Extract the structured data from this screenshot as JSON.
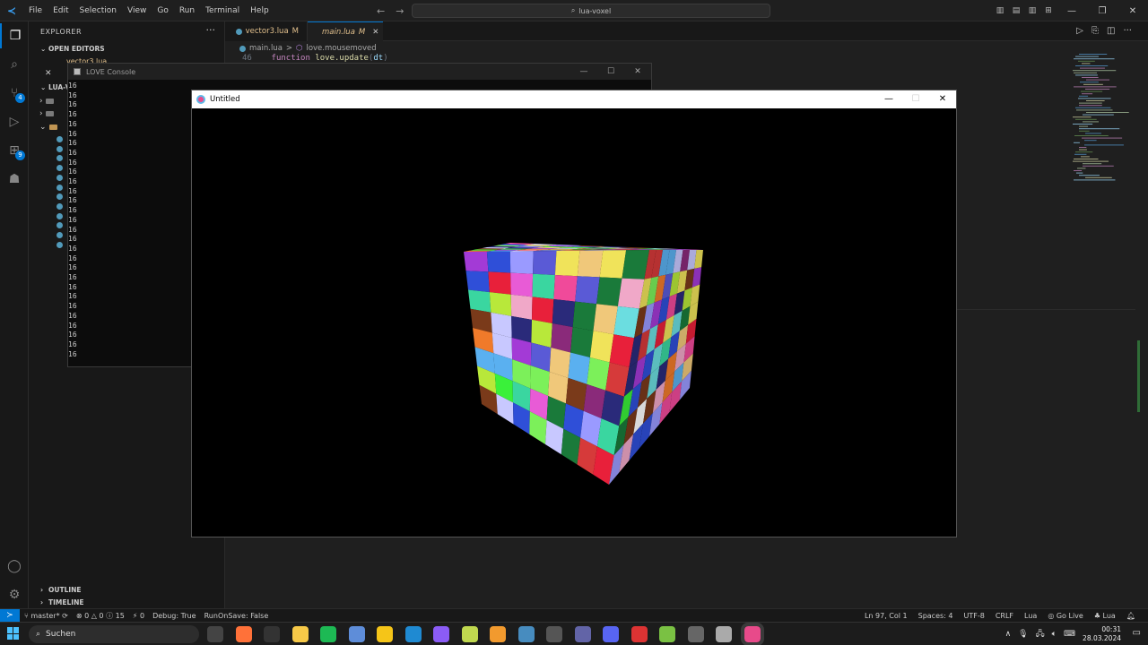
{
  "menu": [
    "File",
    "Edit",
    "Selection",
    "View",
    "Go",
    "Run",
    "Terminal",
    "Help"
  ],
  "command_center": "lua-voxel",
  "sidebar": {
    "header": "EXPLORER",
    "open_editors": {
      "title": "OPEN EDITORS",
      "items": [
        {
          "name": "vector3.lua",
          "status": "M"
        }
      ]
    },
    "workspace_title": "LUA-VO",
    "outline_title": "OUTLINE",
    "timeline_title": "TIMELINE"
  },
  "tabs": [
    {
      "label": "vector3.lua",
      "status": "M"
    },
    {
      "label": "main.lua",
      "status": "M"
    }
  ],
  "breadcrumb": {
    "file": "main.lua",
    "separator": ">",
    "symbol": "love.mousemoved"
  },
  "code_peek": {
    "line_no": "46",
    "keyword": "function",
    "name": "love.update",
    "param": "dt"
  },
  "console": {
    "title": "LOVE Console",
    "lines": [
      "16",
      "16",
      "16",
      "16",
      "16",
      "16",
      "16",
      "16",
      "16",
      "16",
      "16",
      "16",
      "16",
      "16",
      "16",
      "16",
      "16",
      "16",
      "16",
      "16",
      "16",
      "16",
      "16",
      "16",
      "16",
      "16",
      "16",
      "16",
      "16"
    ]
  },
  "game_window": {
    "title": "Untitled"
  },
  "statusbar": {
    "branch": "master*",
    "errors": "0",
    "warnings": "0",
    "info": "15",
    "ports": "0",
    "debug": "Debug: True",
    "runonsave": "RunOnSave: False",
    "position": "Ln 97, Col 1",
    "spaces": "Spaces: 4",
    "encoding": "UTF-8",
    "eol": "CRLF",
    "language": "Lua",
    "golive": "Go Live",
    "lang2": "Lua"
  },
  "taskbar": {
    "search_placeholder": "Suchen",
    "time": "00:31",
    "date": "28.03.2024"
  },
  "activity_badges": {
    "scm": "4",
    "extensions": "9"
  },
  "colors": {
    "accent": "#0078d4",
    "modified": "#e2c08d",
    "lua": "#519aba"
  }
}
